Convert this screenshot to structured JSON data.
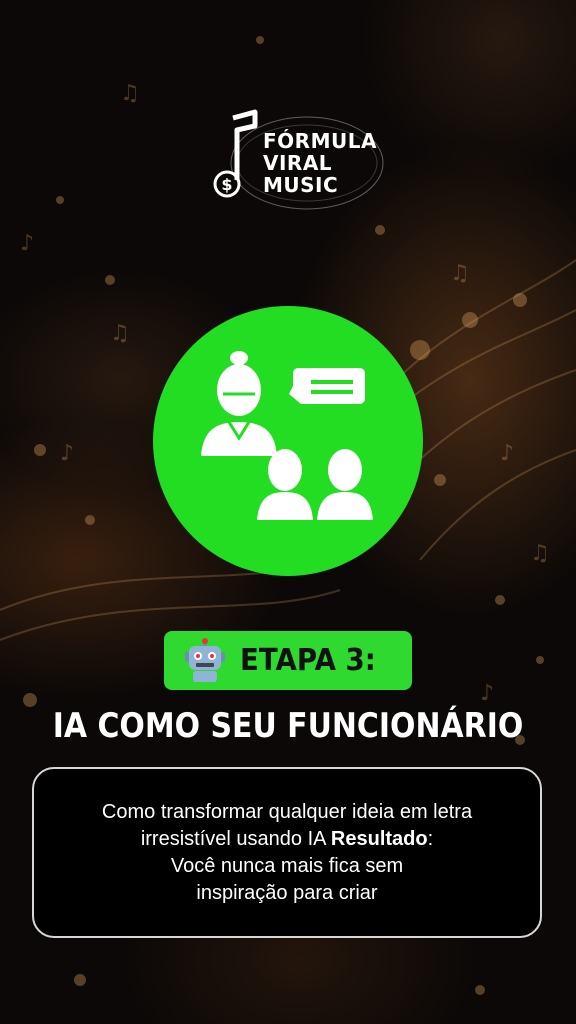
{
  "brand": {
    "logo_line1": "FÓRMULA",
    "logo_line2": "VIRAL",
    "logo_line3": "MUSIC",
    "accent_color": "#22dd22"
  },
  "illustration": {
    "icon": "presenter-with-audience-icon",
    "background_color": "#22dd22"
  },
  "step": {
    "emoji_icon": "robot-icon",
    "label": "ETAPA 3:"
  },
  "headline": "IA COMO SEU FUNCIONÁRIO",
  "description": {
    "line1": "Como transformar qualquer ideia em letra",
    "line2_prefix": "irresistível usando IA ",
    "line2_bold": "Resultado",
    "line2_suffix": ":",
    "line3": "Você nunca mais fica sem",
    "line4": "inspiração para criar"
  }
}
